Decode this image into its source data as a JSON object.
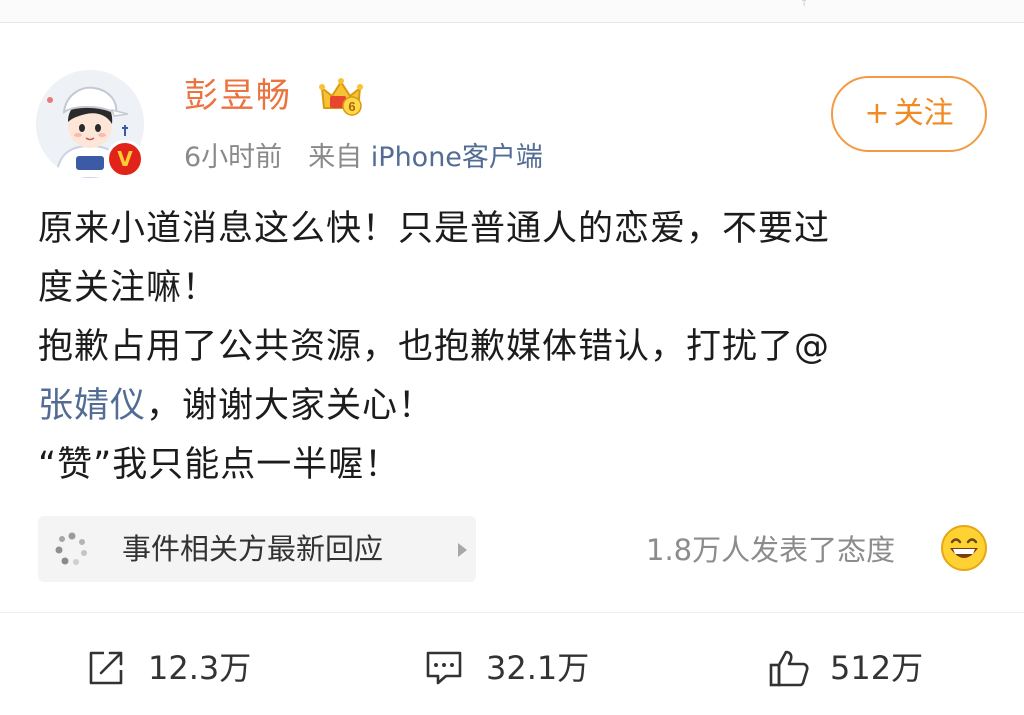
{
  "user": {
    "name": "彭昱畅",
    "level": "6",
    "verified_badge": "V",
    "time": "6小时前",
    "source_prefix": "来自",
    "source": "iPhone客户端"
  },
  "follow_button": {
    "plus": "+",
    "label": "关注"
  },
  "post": {
    "lines": [
      "原来小道消息这么快！只是普通人的恋爱，不要过",
      "度关注嘛！",
      "抱歉占用了公共资源，也抱歉媒体错认，打扰了@",
      "，谢谢大家关心！",
      "“赞”我只能点一半喔！"
    ],
    "mention": "张婧仪"
  },
  "event_card": {
    "label": "事件相关方最新回应"
  },
  "attitude": {
    "text": "1.8万人发表了态度"
  },
  "actions": {
    "share_count": "12.3万",
    "comment_count": "32.1万",
    "like_count": "512万"
  },
  "colors": {
    "name": "#eb7340",
    "link": "#526c94",
    "follow": "#f08a22",
    "badge": "#e2231a"
  },
  "icons": [
    "crown-icon",
    "verified-icon",
    "dots-icon",
    "arrow-right-icon",
    "grin-emoji-icon",
    "share-icon",
    "comment-icon",
    "like-icon"
  ]
}
